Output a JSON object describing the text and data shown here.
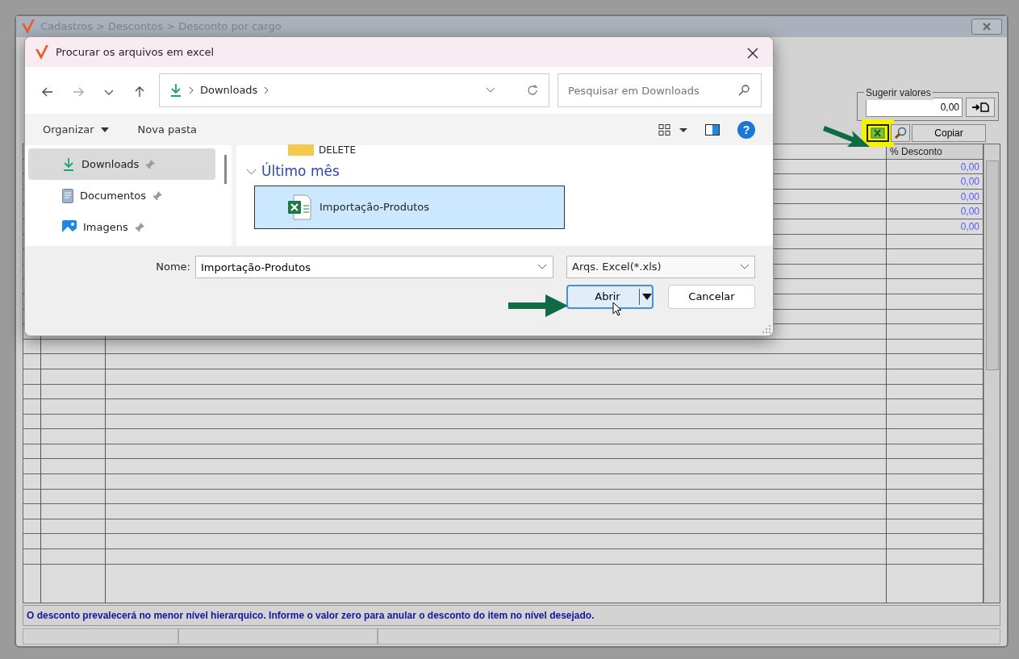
{
  "app": {
    "title": "Cadastros > Descontos > Desconto por cargo",
    "suggest": {
      "label": "Sugerir valores",
      "value": "0,00"
    },
    "toolbar": [
      {
        "kind": "excel",
        "highlighted": true
      },
      {
        "kind": "search",
        "highlighted": false
      },
      {
        "kind": "text",
        "label": "Copiar",
        "highlighted": false
      }
    ],
    "grid": {
      "header": "% Desconto",
      "rows": [
        "0,00",
        "0,00",
        "0,00",
        "0,00",
        "0,00"
      ]
    },
    "hint": "O desconto prevalecerá no menor nível hierarquico. Informe o valor zero para anular o desconto do item no nível desejado."
  },
  "dialog": {
    "title": "Procurar os arquivos em excel",
    "path": "Downloads",
    "search": {
      "placeholder": "Pesquisar em Downloads"
    },
    "commands": [
      "Organizar",
      "Nova pasta"
    ],
    "sidebar": [
      {
        "label": "Downloads",
        "kind": "download",
        "selected": true
      },
      {
        "label": "Documentos",
        "kind": "document",
        "selected": false
      },
      {
        "label": "Imagens",
        "kind": "image",
        "selected": false
      }
    ],
    "folder": "DELETE",
    "group": "Último mês",
    "files": [
      {
        "name": "Importação-Produtos",
        "selected": true
      }
    ],
    "name_label": "Nome:",
    "name_value": "Importação-Produtos",
    "filetype": "Arqs. Excel(*.xls)",
    "open_button": "Abrir",
    "cancel_button": "Cancelar",
    "help_button": "?"
  }
}
